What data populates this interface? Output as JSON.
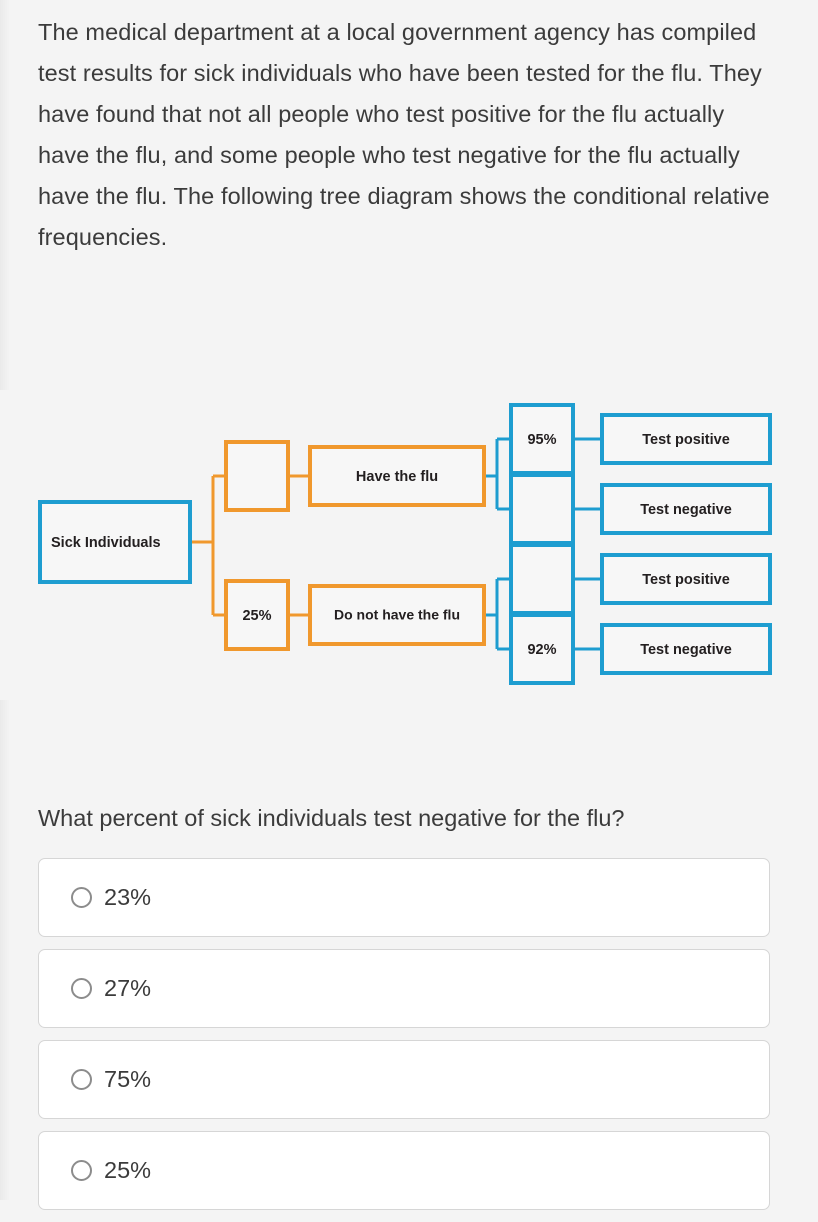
{
  "prompt": {
    "text": "The medical department at a local government agency has compiled test results for sick individuals who have been tested for the flu. They have found that not all people who test positive for the flu actually have the flu, and some people who test negative for the flu actually have the flu. The following tree diagram shows the conditional relative frequencies."
  },
  "diagram": {
    "type": "tree-diagram",
    "colors": {
      "root_border": "#1e9dd0",
      "branch_orange": "#f0982d",
      "branch_teal": "#1e9dd0",
      "box_fill": "#f7f7f7",
      "background": "#f4f4f4"
    },
    "root": {
      "label": "Sick Individuals"
    },
    "branches": [
      {
        "percent": "",
        "label": "Have the flu",
        "children": [
          {
            "percent": "95%",
            "label": "Test positive"
          },
          {
            "percent": "",
            "label": "Test negative"
          }
        ]
      },
      {
        "percent": "25%",
        "label": "Do not have the flu",
        "children": [
          {
            "percent": "",
            "label": "Test positive"
          },
          {
            "percent": "92%",
            "label": "Test negative"
          }
        ]
      }
    ]
  },
  "question": {
    "text": "What percent of sick individuals test negative for the flu?"
  },
  "options": [
    {
      "label": "23%",
      "selected": false
    },
    {
      "label": "27%",
      "selected": false
    },
    {
      "label": "75%",
      "selected": false
    },
    {
      "label": "25%",
      "selected": false
    }
  ]
}
